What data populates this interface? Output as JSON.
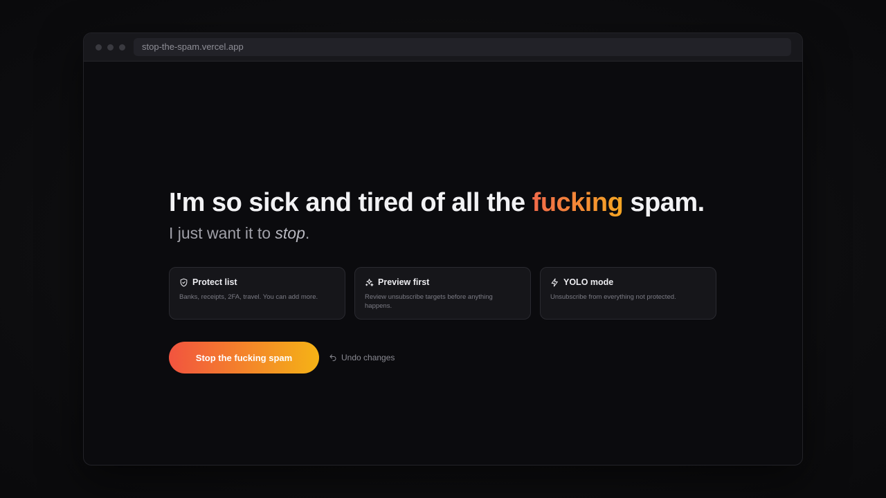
{
  "browser": {
    "url": "stop-the-spam.vercel.app"
  },
  "hero": {
    "headline_before": "I'm so sick and tired of all the ",
    "headline_accent": "fucking",
    "headline_after": " spam.",
    "sub_before": "I just want it to ",
    "sub_emphasis": "stop",
    "sub_after": "."
  },
  "cards": [
    {
      "icon": "shield-check-icon",
      "title": "Protect list",
      "description": "Banks, receipts, 2FA, travel. You can add more."
    },
    {
      "icon": "sparkles-icon",
      "title": "Preview first",
      "description": "Review unsubscribe targets before anything happens."
    },
    {
      "icon": "lightning-bolt-icon",
      "title": "YOLO mode",
      "description": "Unsubscribe from everything not protected."
    }
  ],
  "actions": {
    "primary_label": "Stop the fucking spam",
    "undo_label": "Undo changes",
    "undo_icon": "undo-arrow-icon"
  },
  "colors": {
    "accent_start": "#f2543f",
    "accent_end": "#f5b316",
    "background": "#0b0b0e"
  }
}
